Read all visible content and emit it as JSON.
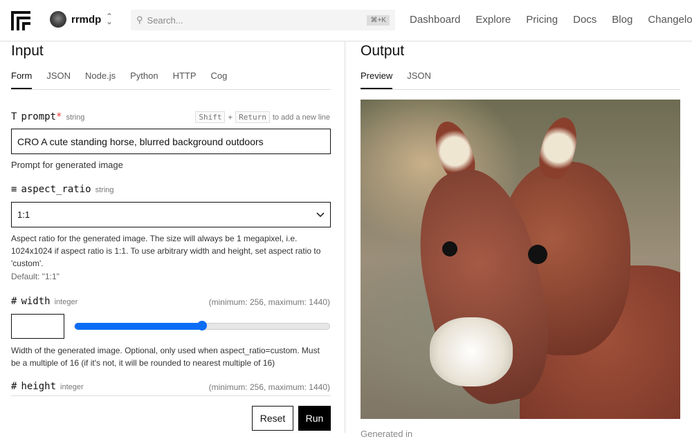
{
  "header": {
    "user": "rrmdp",
    "search_placeholder": "Search...",
    "shortcut": "⌘+K",
    "nav": [
      "Dashboard",
      "Explore",
      "Pricing",
      "Docs",
      "Blog",
      "Changelog"
    ]
  },
  "input": {
    "title": "Input",
    "tabs": [
      "Form",
      "JSON",
      "Node.js",
      "Python",
      "HTTP",
      "Cog"
    ],
    "prompt": {
      "icon": "T",
      "name": "prompt",
      "required": "*",
      "type": "string",
      "hint_key1": "Shift",
      "hint_plus": "+",
      "hint_key2": "Return",
      "hint_text": "to add a new line",
      "value": "CRO A cute standing horse, blurred background outdoors",
      "description": "Prompt for generated image"
    },
    "aspect_ratio": {
      "icon": "≡",
      "name": "aspect_ratio",
      "type": "string",
      "value": "1:1",
      "description": "Aspect ratio for the generated image. The size will always be 1 megapixel, i.e. 1024x1024 if aspect ratio is 1:1. To use arbitrary width and height, set aspect ratio to 'custom'.",
      "default": "Default: \"1:1\""
    },
    "width": {
      "icon": "#",
      "name": "width",
      "type": "integer",
      "range": "(minimum: 256, maximum: 1440)",
      "value": "",
      "slider_fraction": 0.5,
      "description": "Width of the generated image. Optional, only used when aspect_ratio=custom. Must be a multiple of 16 (if it's not, it will be rounded to nearest multiple of 16)"
    },
    "height": {
      "icon": "#",
      "name": "height",
      "type": "integer",
      "range": "(minimum: 256, maximum: 1440)"
    },
    "reset": "Reset",
    "run": "Run"
  },
  "output": {
    "title": "Output",
    "tabs": [
      "Preview",
      "JSON"
    ],
    "generated": "Generated in"
  },
  "colors": {
    "accent": "#0a6cf5"
  }
}
